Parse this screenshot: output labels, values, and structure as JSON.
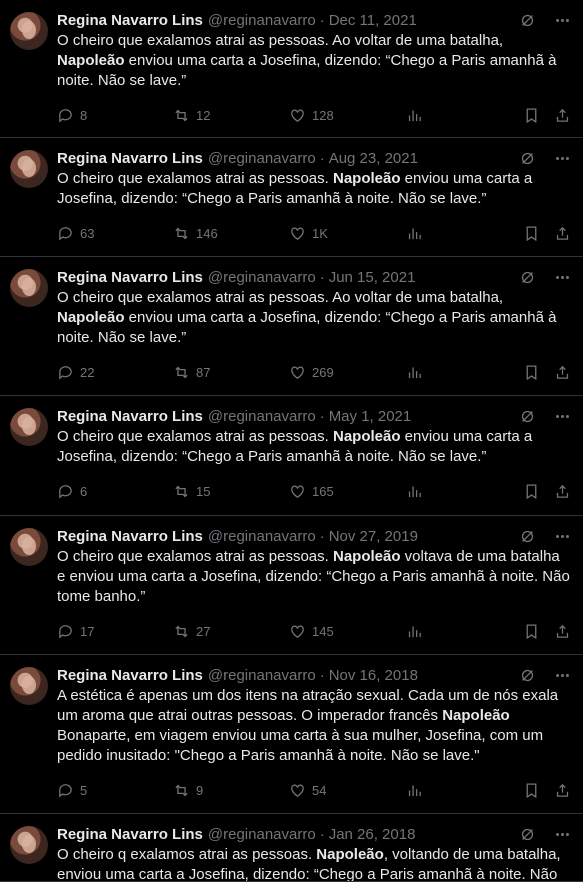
{
  "tweets": [
    {
      "name": "Regina Navarro Lins",
      "handle": "@reginanavarro",
      "date": "Dec 11, 2021",
      "text_parts": [
        "O cheiro que exalamos atrai as pessoas. Ao voltar de uma batalha, ",
        "Napoleão",
        " enviou uma carta a Josefina, dizendo: “Chego a Paris amanhã à noite. Não se lave.”"
      ],
      "replies": "8",
      "retweets": "12",
      "likes": "128"
    },
    {
      "name": "Regina Navarro Lins",
      "handle": "@reginanavarro",
      "date": "Aug 23, 2021",
      "text_parts": [
        "O cheiro que exalamos atrai as pessoas. ",
        "Napoleão",
        " enviou uma carta a Josefina, dizendo: “Chego a Paris amanhã à noite. Não se lave.”"
      ],
      "replies": "63",
      "retweets": "146",
      "likes": "1K"
    },
    {
      "name": "Regina Navarro Lins",
      "handle": "@reginanavarro",
      "date": "Jun 15, 2021",
      "text_parts": [
        "O cheiro que exalamos atrai as pessoas. Ao voltar de uma batalha, ",
        "Napoleão",
        " enviou uma carta a Josefina, dizendo: “Chego a Paris amanhã à noite. Não se lave.”"
      ],
      "replies": "22",
      "retweets": "87",
      "likes": "269"
    },
    {
      "name": "Regina Navarro Lins",
      "handle": "@reginanavarro",
      "date": "May 1, 2021",
      "text_parts": [
        "O cheiro que exalamos atrai as pessoas. ",
        "Napoleão",
        " enviou uma carta a Josefina, dizendo: “Chego a Paris amanhã à noite. Não se lave.”"
      ],
      "replies": "6",
      "retweets": "15",
      "likes": "165"
    },
    {
      "name": "Regina Navarro Lins",
      "handle": "@reginanavarro",
      "date": "Nov 27, 2019",
      "text_parts": [
        "O cheiro que exalamos atrai as pessoas. ",
        "Napoleão",
        " voltava de uma batalha e enviou uma carta a Josefina, dizendo: “Chego a Paris amanhã à noite. Não tome banho.”"
      ],
      "replies": "17",
      "retweets": "27",
      "likes": "145"
    },
    {
      "name": "Regina Navarro Lins",
      "handle": "@reginanavarro",
      "date": "Nov 16, 2018",
      "text_parts": [
        "A estética é apenas um dos itens na atração sexual. Cada um de nós exala um aroma que atrai outras pessoas. O imperador francês ",
        "Napoleão",
        " Bonaparte, em viagem enviou uma carta à sua mulher, Josefina, com um pedido inusitado: \"Chego a Paris amanhã à noite. Não se lave.\""
      ],
      "replies": "5",
      "retweets": "9",
      "likes": "54"
    },
    {
      "name": "Regina Navarro Lins",
      "handle": "@reginanavarro",
      "date": "Jan 26, 2018",
      "text_parts": [
        "O cheiro q exalamos atrai as pessoas. ",
        "Napoleão",
        ", voltando de uma batalha, enviou uma carta a Josefina, dizendo: “Chego a Paris amanhã à noite. Não"
      ],
      "replies": "",
      "retweets": "",
      "likes": ""
    }
  ]
}
